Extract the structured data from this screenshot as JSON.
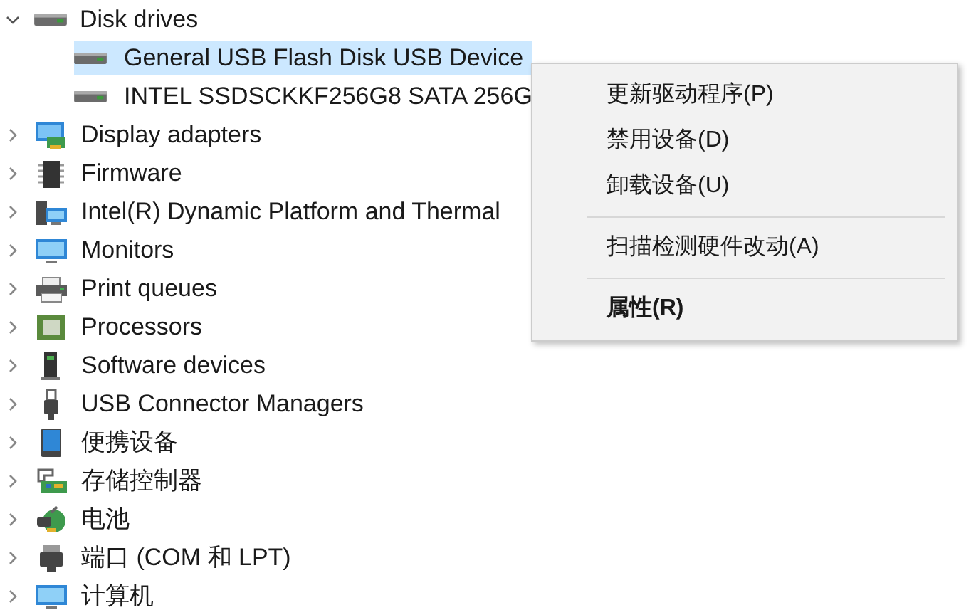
{
  "tree": [
    {
      "label": "Disk drives",
      "kind": "disk",
      "expanded": true,
      "children": [
        {
          "label": "General USB Flash Disk USB Device",
          "kind": "disk",
          "selected": true
        },
        {
          "label": "INTEL SSDSCKKF256G8 SATA 256G",
          "kind": "disk",
          "selected": false
        }
      ]
    },
    {
      "label": "Display adapters",
      "kind": "display",
      "expanded": false
    },
    {
      "label": "Firmware",
      "kind": "chip",
      "expanded": false
    },
    {
      "label": "Intel(R) Dynamic Platform and Thermal",
      "kind": "computer",
      "expanded": false
    },
    {
      "label": "Monitors",
      "kind": "monitor",
      "expanded": false
    },
    {
      "label": "Print queues",
      "kind": "printer",
      "expanded": false
    },
    {
      "label": "Processors",
      "kind": "cpu",
      "expanded": false
    },
    {
      "label": "Software devices",
      "kind": "tower",
      "expanded": false
    },
    {
      "label": "USB Connector Managers",
      "kind": "usb",
      "expanded": false
    },
    {
      "label": "便携设备",
      "kind": "portable",
      "expanded": false
    },
    {
      "label": "存储控制器",
      "kind": "storage",
      "expanded": false
    },
    {
      "label": "电池",
      "kind": "battery",
      "expanded": false
    },
    {
      "label": "端口 (COM 和 LPT)",
      "kind": "port",
      "expanded": false
    },
    {
      "label": "计算机",
      "kind": "monitor",
      "expanded": false
    }
  ],
  "context_menu": [
    {
      "label": "更新驱动程序(P)",
      "kind": "item",
      "bold": false
    },
    {
      "label": "禁用设备(D)",
      "kind": "item",
      "bold": false
    },
    {
      "label": "卸载设备(U)",
      "kind": "item",
      "bold": false
    },
    {
      "kind": "separator"
    },
    {
      "label": "扫描检测硬件改动(A)",
      "kind": "item",
      "bold": false
    },
    {
      "kind": "separator"
    },
    {
      "label": "属性(R)",
      "kind": "item",
      "bold": true
    }
  ]
}
